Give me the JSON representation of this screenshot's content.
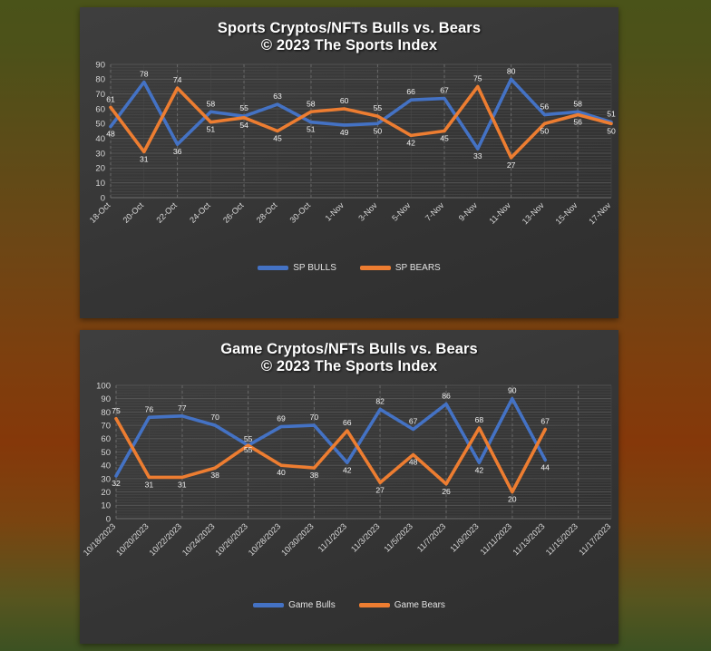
{
  "theme": {
    "bulls_color": "#4472C4",
    "bears_color": "#ED7D31",
    "panel_bg": "#3a3a3a",
    "page_bg_top": "#4a5319",
    "page_bg_mid": "#85380a",
    "page_bg_bottom": "#3c5222",
    "label_color": "#f2f2f2"
  },
  "charts": [
    {
      "id": "sports-chart",
      "title_line1": "Sports Cryptos/NFTs Bulls vs. Bears",
      "title_line2": "© 2023 The Sports Index",
      "legend": [
        {
          "label": "SP BULLS",
          "color": "#4472C4"
        },
        {
          "label": "SP BEARS",
          "color": "#ED7D31"
        }
      ],
      "chart_data": {
        "type": "line",
        "title": "Sports Cryptos/NFTs Bulls vs. Bears © 2023 The Sports Index",
        "xlabel": "",
        "ylabel": "",
        "ylim": [
          0,
          90
        ],
        "yticks": [
          0,
          10,
          20,
          30,
          40,
          50,
          60,
          70,
          80,
          90
        ],
        "grid": true,
        "legend_position": "bottom",
        "categories": [
          "18-Oct",
          "20-Oct",
          "22-Oct",
          "24-Oct",
          "26-Oct",
          "28-Oct",
          "30-Oct",
          "1-Nov",
          "3-Nov",
          "5-Nov",
          "7-Nov",
          "9-Nov",
          "11-Nov",
          "13-Nov",
          "15-Nov",
          "17-Nov"
        ],
        "series": [
          {
            "name": "SP BULLS",
            "color": "#4472C4",
            "values": [
              48,
              78,
              36,
              58,
              55,
              63,
              51,
              49,
              50,
              66,
              67,
              33,
              80,
              56,
              58,
              51
            ]
          },
          {
            "name": "SP BEARS",
            "color": "#ED7D31",
            "values": [
              61,
              31,
              74,
              51,
              54,
              45,
              58,
              60,
              55,
              42,
              45,
              75,
              27,
              50,
              56,
              50
            ]
          }
        ]
      }
    },
    {
      "id": "game-chart",
      "title_line1": "Game Cryptos/NFTs Bulls vs. Bears",
      "title_line2": "© 2023 The Sports Index",
      "legend": [
        {
          "label": "Game Bulls",
          "color": "#4472C4"
        },
        {
          "label": "Game Bears",
          "color": "#ED7D31"
        }
      ],
      "chart_data": {
        "type": "line",
        "title": "Game Cryptos/NFTs Bulls vs. Bears © 2023 The Sports Index",
        "xlabel": "",
        "ylabel": "",
        "ylim": [
          0,
          100
        ],
        "yticks": [
          0,
          10,
          20,
          30,
          40,
          50,
          60,
          70,
          80,
          90,
          100
        ],
        "grid": true,
        "legend_position": "bottom",
        "categories": [
          "10/18/2023",
          "10/20/2023",
          "10/22/2023",
          "10/24/2023",
          "10/26/2023",
          "10/28/2023",
          "10/30/2023",
          "11/1/2023",
          "11/3/2023",
          "11/5/2023",
          "11/7/2023",
          "11/9/2023",
          "11/11/2023",
          "11/13/2023",
          "11/15/2023",
          "11/17/2023"
        ],
        "series": [
          {
            "name": "Game Bulls",
            "color": "#4472C4",
            "values": [
              32,
              76,
              77,
              70,
              55,
              69,
              70,
              42,
              82,
              67,
              86,
              42,
              90,
              44
            ]
          },
          {
            "name": "Game Bears",
            "color": "#ED7D31",
            "values": [
              75,
              31,
              31,
              38,
              55,
              40,
              38,
              66,
              27,
              48,
              26,
              68,
              20,
              67
            ]
          }
        ]
      }
    }
  ]
}
